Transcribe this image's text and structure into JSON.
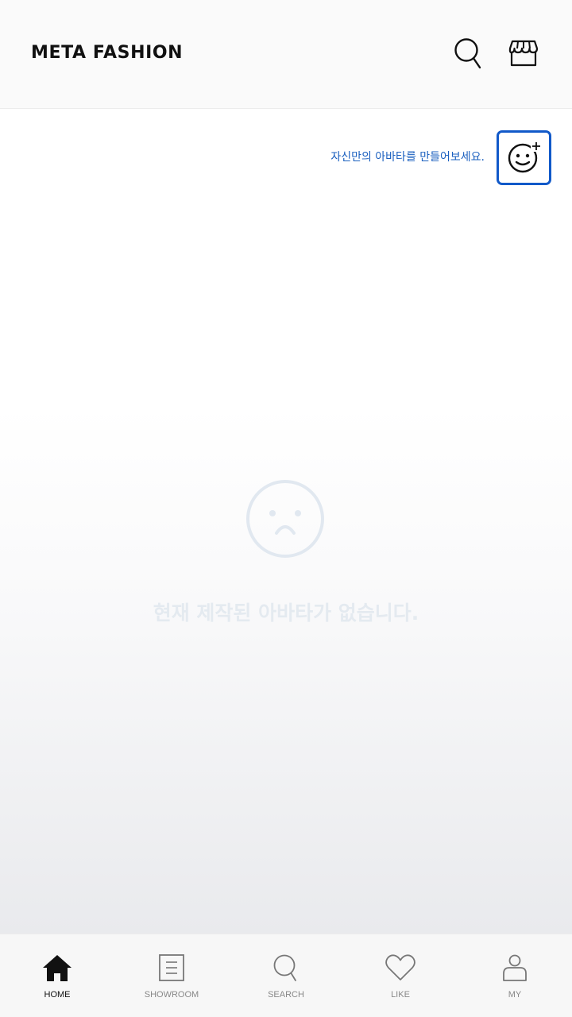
{
  "header": {
    "logo": "META FASHION",
    "icons": [
      "search-icon",
      "store-icon"
    ]
  },
  "avatar": {
    "prompt": "자신만의 아바타를 만들어보세요.",
    "add_icon": "face-plus-icon",
    "accent_color": "#1159c9"
  },
  "empty_state": {
    "icon": "sad-face-icon",
    "message": "현재 제작된 아바타가 없습니다."
  },
  "tabbar": {
    "tabs": [
      {
        "label": "HOME",
        "icon": "home-icon",
        "active": true
      },
      {
        "label": "SHOWROOM",
        "icon": "showroom-icon",
        "active": false
      },
      {
        "label": "SEARCH",
        "icon": "search-icon",
        "active": false
      },
      {
        "label": "LIKE",
        "icon": "heart-icon",
        "active": false
      },
      {
        "label": "MY",
        "icon": "user-icon",
        "active": false
      }
    ]
  }
}
